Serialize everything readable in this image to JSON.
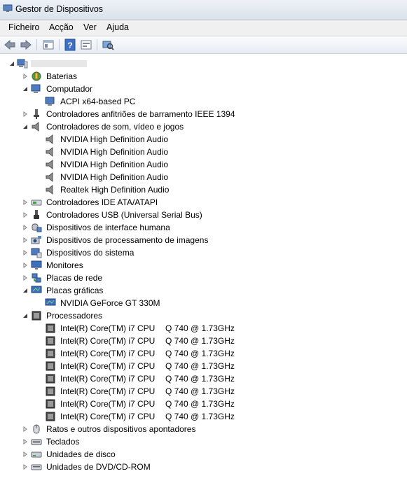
{
  "window": {
    "title": "Gestor de Dispositivos"
  },
  "menu": [
    "Ficheiro",
    "Acção",
    "Ver",
    "Ajuda"
  ],
  "toolbar": [
    "back-icon",
    "forward-icon",
    "properties-icon",
    "help-icon",
    "update-driver-icon",
    "scan-hardware-icon"
  ],
  "tree": {
    "root": {
      "label": ""
    },
    "items": [
      {
        "label": "Baterias",
        "icon": "battery-icon",
        "level": 1,
        "expanded": false
      },
      {
        "label": "Computador",
        "icon": "computer-icon",
        "level": 1,
        "expanded": true
      },
      {
        "label": "ACPI x64-based PC",
        "icon": "computer-icon",
        "level": 2,
        "expanded": null
      },
      {
        "label": "Controladores anfitriões de barramento IEEE 1394",
        "icon": "ieee1394-icon",
        "level": 1,
        "expanded": false
      },
      {
        "label": "Controladores de som, vídeo e jogos",
        "icon": "speaker-icon",
        "level": 1,
        "expanded": true
      },
      {
        "label": "NVIDIA High Definition Audio",
        "icon": "speaker-icon",
        "level": 2,
        "expanded": null
      },
      {
        "label": "NVIDIA High Definition Audio",
        "icon": "speaker-icon",
        "level": 2,
        "expanded": null
      },
      {
        "label": "NVIDIA High Definition Audio",
        "icon": "speaker-icon",
        "level": 2,
        "expanded": null
      },
      {
        "label": "NVIDIA High Definition Audio",
        "icon": "speaker-icon",
        "level": 2,
        "expanded": null
      },
      {
        "label": "Realtek High Definition Audio",
        "icon": "speaker-icon",
        "level": 2,
        "expanded": null
      },
      {
        "label": "Controladores IDE ATA/ATAPI",
        "icon": "ide-icon",
        "level": 1,
        "expanded": false
      },
      {
        "label": "Controladores USB (Universal Serial Bus)",
        "icon": "usb-icon",
        "level": 1,
        "expanded": false
      },
      {
        "label": "Dispositivos de interface humana",
        "icon": "hid-icon",
        "level": 1,
        "expanded": false
      },
      {
        "label": "Dispositivos de processamento de imagens",
        "icon": "camera-icon",
        "level": 1,
        "expanded": false
      },
      {
        "label": "Dispositivos do sistema",
        "icon": "system-icon",
        "level": 1,
        "expanded": false
      },
      {
        "label": "Monitores",
        "icon": "monitor-icon",
        "level": 1,
        "expanded": false
      },
      {
        "label": "Placas de rede",
        "icon": "network-icon",
        "level": 1,
        "expanded": false
      },
      {
        "label": "Placas gráficas",
        "icon": "display-icon",
        "level": 1,
        "expanded": true
      },
      {
        "label": "NVIDIA GeForce GT 330M",
        "icon": "display-icon",
        "level": 2,
        "expanded": null
      },
      {
        "label": "Processadores",
        "icon": "cpu-icon",
        "level": 1,
        "expanded": true
      },
      {
        "label": "Intel(R) Core(TM) i7 CPU",
        "suffix": "Q 740  @ 1.73GHz",
        "icon": "cpu-icon",
        "level": 2,
        "expanded": null
      },
      {
        "label": "Intel(R) Core(TM) i7 CPU",
        "suffix": "Q 740  @ 1.73GHz",
        "icon": "cpu-icon",
        "level": 2,
        "expanded": null
      },
      {
        "label": "Intel(R) Core(TM) i7 CPU",
        "suffix": "Q 740  @ 1.73GHz",
        "icon": "cpu-icon",
        "level": 2,
        "expanded": null
      },
      {
        "label": "Intel(R) Core(TM) i7 CPU",
        "suffix": "Q 740  @ 1.73GHz",
        "icon": "cpu-icon",
        "level": 2,
        "expanded": null
      },
      {
        "label": "Intel(R) Core(TM) i7 CPU",
        "suffix": "Q 740  @ 1.73GHz",
        "icon": "cpu-icon",
        "level": 2,
        "expanded": null
      },
      {
        "label": "Intel(R) Core(TM) i7 CPU",
        "suffix": "Q 740  @ 1.73GHz",
        "icon": "cpu-icon",
        "level": 2,
        "expanded": null
      },
      {
        "label": "Intel(R) Core(TM) i7 CPU",
        "suffix": "Q 740  @ 1.73GHz",
        "icon": "cpu-icon",
        "level": 2,
        "expanded": null
      },
      {
        "label": "Intel(R) Core(TM) i7 CPU",
        "suffix": "Q 740  @ 1.73GHz",
        "icon": "cpu-icon",
        "level": 2,
        "expanded": null
      },
      {
        "label": "Ratos e outros dispositivos apontadores",
        "icon": "mouse-icon",
        "level": 1,
        "expanded": false
      },
      {
        "label": "Teclados",
        "icon": "keyboard-icon",
        "level": 1,
        "expanded": false
      },
      {
        "label": "Unidades de disco",
        "icon": "disk-icon",
        "level": 1,
        "expanded": false
      },
      {
        "label": "Unidades de DVD/CD-ROM",
        "icon": "dvd-icon",
        "level": 1,
        "expanded": false
      }
    ]
  }
}
